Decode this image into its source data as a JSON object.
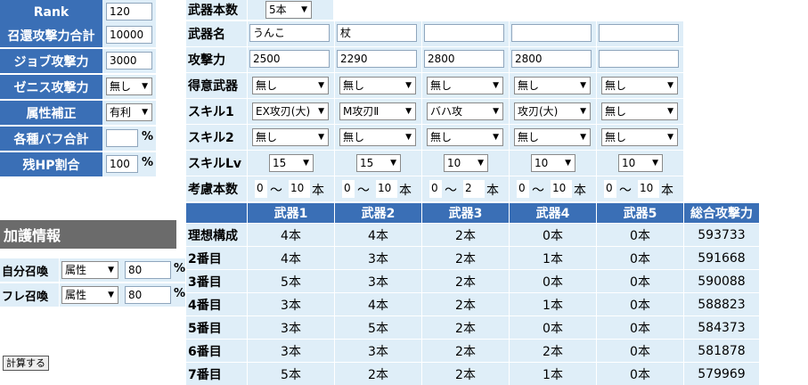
{
  "left_params": [
    {
      "label": "Rank",
      "value": "120",
      "type": "input"
    },
    {
      "label": "召還攻撃力合計",
      "value": "10000",
      "type": "input"
    },
    {
      "label": "ジョブ攻撃力",
      "value": "3000",
      "type": "input"
    },
    {
      "label": "ゼニス攻撃力",
      "value": "無し",
      "type": "select"
    },
    {
      "label": "属性補正",
      "value": "有利",
      "type": "select"
    },
    {
      "label": "各種バフ合計",
      "value": "",
      "type": "input",
      "suffix": "%"
    },
    {
      "label": "残HP割合",
      "value": "100",
      "type": "input",
      "suffix": "%"
    }
  ],
  "protection": {
    "title": "加護情報",
    "rows": [
      {
        "label": "自分召喚",
        "select": "属性",
        "value": "80",
        "suffix": "%"
      },
      {
        "label": "フレ召喚",
        "select": "属性",
        "value": "80",
        "suffix": "%"
      }
    ]
  },
  "calc_button": "計算する",
  "weapon_count": {
    "label": "武器本数",
    "value": "5本"
  },
  "weapon_rows": {
    "names": {
      "label": "武器名",
      "values": [
        "うんこ",
        "杖",
        "",
        "",
        ""
      ]
    },
    "attack": {
      "label": "攻撃力",
      "values": [
        "2500",
        "2290",
        "2800",
        "2800",
        ""
      ]
    },
    "specialty": {
      "label": "得意武器",
      "values": [
        "無し",
        "無し",
        "無し",
        "無し",
        "無し"
      ]
    },
    "skill1": {
      "label": "スキル1",
      "values": [
        "EX攻刃(大)",
        "M攻刃Ⅱ",
        "バハ攻",
        "攻刃(大)",
        "無し"
      ]
    },
    "skill2": {
      "label": "スキル2",
      "values": [
        "無し",
        "無し",
        "無し",
        "無し",
        "無し"
      ]
    },
    "skill_lv": {
      "label": "スキルLv",
      "values": [
        "15",
        "15",
        "10",
        "10",
        "10"
      ]
    },
    "range": {
      "label": "考慮本数",
      "values": [
        {
          "min": "0",
          "sep": "〜",
          "max": "10",
          "unit": "本"
        },
        {
          "min": "0",
          "sep": "〜",
          "max": "10",
          "unit": "本"
        },
        {
          "min": "0",
          "sep": "〜",
          "max": "2",
          "unit": "本"
        },
        {
          "min": "0",
          "sep": "〜",
          "max": "10",
          "unit": "本"
        },
        {
          "min": "0",
          "sep": "〜",
          "max": "10",
          "unit": "本"
        }
      ]
    }
  },
  "results": {
    "headers": [
      "武器1",
      "武器2",
      "武器3",
      "武器4",
      "武器5",
      "総合攻撃力"
    ],
    "rows": [
      {
        "label": "理想構成",
        "values": [
          "4本",
          "4本",
          "2本",
          "0本",
          "0本",
          "593733"
        ]
      },
      {
        "label": "2番目",
        "values": [
          "4本",
          "3本",
          "2本",
          "1本",
          "0本",
          "591668"
        ]
      },
      {
        "label": "3番目",
        "values": [
          "5本",
          "3本",
          "2本",
          "0本",
          "0本",
          "590088"
        ]
      },
      {
        "label": "4番目",
        "values": [
          "3本",
          "4本",
          "2本",
          "1本",
          "0本",
          "588823"
        ]
      },
      {
        "label": "5番目",
        "values": [
          "3本",
          "5本",
          "2本",
          "0本",
          "0本",
          "584373"
        ]
      },
      {
        "label": "6番目",
        "values": [
          "3本",
          "3本",
          "2本",
          "2本",
          "0本",
          "581878"
        ]
      },
      {
        "label": "7番目",
        "values": [
          "5本",
          "2本",
          "2本",
          "1本",
          "0本",
          "579969"
        ]
      }
    ]
  },
  "icons": {
    "dropdown": "▼"
  }
}
